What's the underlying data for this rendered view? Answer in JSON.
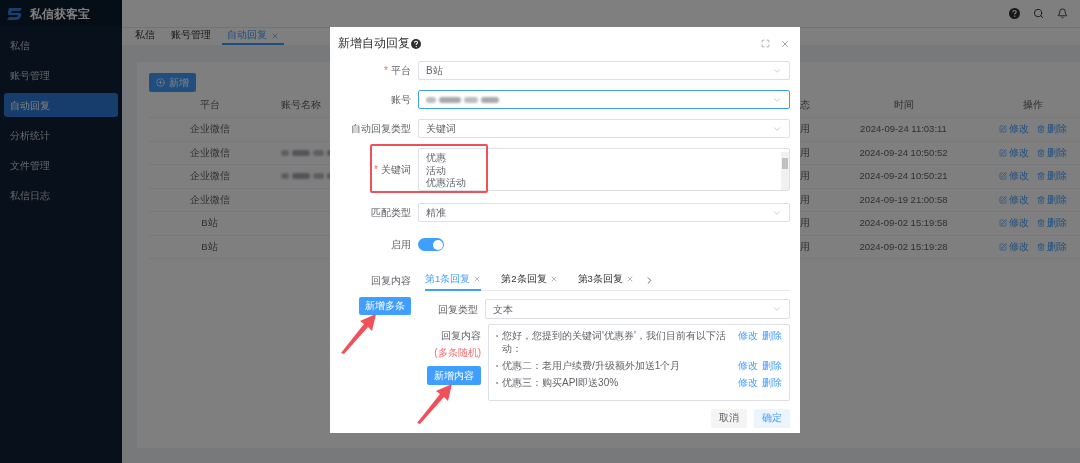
{
  "app": {
    "name": "私信获客宝"
  },
  "sidebar": {
    "items": [
      {
        "label": "私信",
        "selected": false
      },
      {
        "label": "账号管理",
        "selected": false
      },
      {
        "label": "自动回复",
        "selected": true
      },
      {
        "label": "分析统计",
        "selected": false
      },
      {
        "label": "文件管理",
        "selected": false
      },
      {
        "label": "私信日志",
        "selected": false
      }
    ]
  },
  "tabs": [
    {
      "label": "私信",
      "selected": false,
      "closable": false
    },
    {
      "label": "账号管理",
      "selected": false,
      "closable": false
    },
    {
      "label": "自动回复",
      "selected": true,
      "closable": true
    }
  ],
  "new_button": "新增",
  "table": {
    "columns": [
      "平台",
      "账号名称",
      "态",
      "时间",
      "操作"
    ],
    "rows": [
      {
        "platform": "企业微信",
        "account_blurred": false,
        "status": "用",
        "time": "2024-09-24 11:03:11",
        "actions": [
          "修改",
          "删除"
        ]
      },
      {
        "platform": "企业微信",
        "account_blurred": true,
        "status": "用",
        "time": "2024-09-24 10:50:52",
        "actions": [
          "修改",
          "删除"
        ]
      },
      {
        "platform": "企业微信",
        "account_blurred": true,
        "status": "用",
        "time": "2024-09-24 10:50:21",
        "actions": [
          "修改",
          "删除"
        ]
      },
      {
        "platform": "企业微信",
        "account_blurred": false,
        "status": "用",
        "time": "2024-09-19 21:00:58",
        "actions": [
          "修改",
          "删除"
        ]
      },
      {
        "platform": "B站",
        "account_blurred": false,
        "status": "用",
        "time": "2024-09-02 15:19:58",
        "actions": [
          "修改",
          "删除"
        ]
      },
      {
        "platform": "B站",
        "account_blurred": false,
        "status": "用",
        "time": "2024-09-02 15:19:28",
        "actions": [
          "修改",
          "删除"
        ]
      }
    ]
  },
  "dialog": {
    "title": "新增自动回复",
    "required_mark": "*",
    "fields": [
      {
        "kind": "select",
        "label": "平台",
        "required": true,
        "focused": false,
        "value": "B站"
      },
      {
        "kind": "select",
        "label": "账号",
        "required": false,
        "focused": true,
        "value_blurred": true
      },
      {
        "kind": "select",
        "label": "自动回复类型",
        "required": false,
        "focused": false,
        "value": "关键词"
      },
      {
        "kind": "textarea",
        "label": "关键词",
        "required": true,
        "highlighted": true,
        "value_lines": [
          "优惠",
          "活动",
          "优惠活动"
        ]
      },
      {
        "kind": "select",
        "label": "匹配类型",
        "required": false,
        "focused": false,
        "value": "精准"
      },
      {
        "kind": "switch",
        "label": "启用",
        "on": true
      }
    ],
    "reply": {
      "label": "回复内容",
      "add_button": "新增多条",
      "tabs": [
        {
          "label": "第1条回复",
          "selected": true
        },
        {
          "label": "第2条回复",
          "selected": false
        },
        {
          "label": "第3条回复",
          "selected": false
        }
      ],
      "type_label": "回复类型",
      "type_value": "文本",
      "content_label": "回复内容",
      "content_note": "(多条随机)",
      "add_content_button": "新增内容",
      "items": [
        {
          "text": "您好，您提到的关键词'优惠券'，我们目前有以下活动：",
          "actions": [
            "修改",
            "删除"
          ]
        },
        {
          "text": "优惠二：老用户续费/升级额外加送1个月",
          "actions": [
            "修改",
            "删除"
          ]
        },
        {
          "text": "优惠三：购买API即送30%",
          "actions": [
            "修改",
            "删除"
          ]
        }
      ]
    },
    "buttons": [
      {
        "kind": "cancel",
        "label": "取消"
      },
      {
        "kind": "confirm",
        "label": "确定"
      }
    ]
  }
}
